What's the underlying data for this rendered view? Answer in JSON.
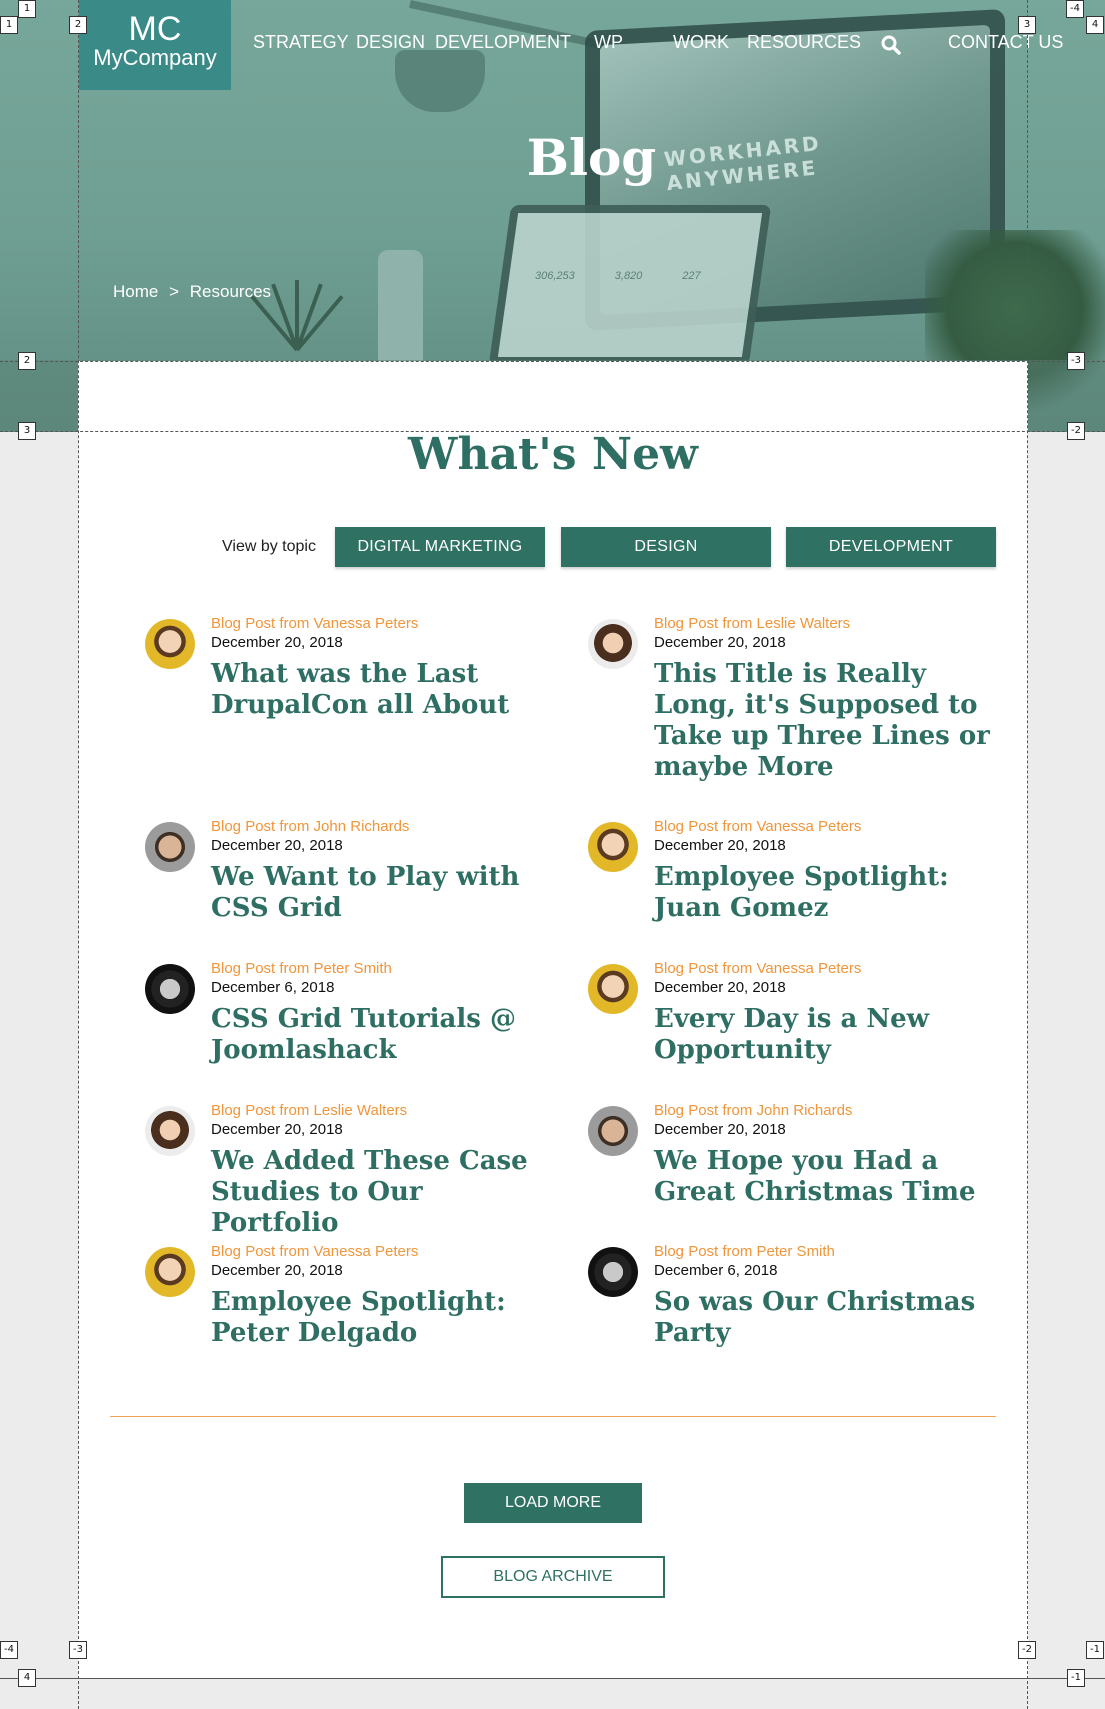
{
  "header": {
    "logo_top": "MC",
    "logo_bottom": "MyCompany",
    "nav": [
      "STRATEGY",
      "DESIGN",
      "DEVELOPMENT",
      "WP",
      "WORK",
      "RESOURCES",
      "CONTACT US"
    ],
    "search_icon": "search-icon"
  },
  "hero": {
    "title": "Blog",
    "breadcrumb": [
      "Home",
      ">",
      "Resources"
    ],
    "background_text": "WORKHARD ANYWHERE",
    "laptop_stats": [
      "306,253",
      "3,820",
      "227"
    ]
  },
  "main": {
    "section_title": "What's New",
    "topic_label": "View by topic",
    "topics": [
      "DIGITAL MARKETING",
      "DESIGN",
      "DEVELOPMENT"
    ],
    "posts": [
      {
        "author": "Blog Post from Vanessa Peters",
        "date": "December 20, 2018",
        "title": "What was the Last DrupalCon all About"
      },
      {
        "author": "Blog Post from Leslie Walters",
        "date": "December 20, 2018",
        "title": "This Title is Really Long, it's Supposed to Take up Three Lines or maybe More"
      },
      {
        "author": "Blog Post from John Richards",
        "date": "December 20, 2018",
        "title": "We Want to Play with CSS Grid"
      },
      {
        "author": "Blog Post from Vanessa Peters",
        "date": "December 20, 2018",
        "title": "Employee Spotlight: Juan Gomez"
      },
      {
        "author": "Blog Post from Peter Smith",
        "date": "December 6, 2018",
        "title": "CSS Grid Tutorials @ Joomlashack"
      },
      {
        "author": "Blog Post from Vanessa Peters",
        "date": "December 20, 2018",
        "title": "Every Day is a New Opportunity"
      },
      {
        "author": "Blog Post from Leslie Walters",
        "date": "December 20, 2018",
        "title": "We Added These Case Studies to Our Portfolio"
      },
      {
        "author": "Blog Post from John Richards",
        "date": "December 20, 2018",
        "title": "We Hope you Had a Great Christmas Time"
      },
      {
        "author": "Blog Post from Vanessa Peters",
        "date": "December 20, 2018",
        "title": "Employee Spotlight: Peter Delgado"
      },
      {
        "author": "Blog Post from Peter Smith",
        "date": "December 6, 2018",
        "title": "So was Our Christmas Party"
      }
    ],
    "load_more": "LOAD MORE",
    "archive": "BLOG ARCHIVE"
  },
  "guides": {
    "markers": [
      "1",
      "2",
      "3",
      "4",
      "-1",
      "-2",
      "-3",
      "-4"
    ]
  },
  "colors": {
    "accent_green": "#2f7163",
    "accent_orange": "#f0953a",
    "logo_teal": "#3a8a87"
  }
}
